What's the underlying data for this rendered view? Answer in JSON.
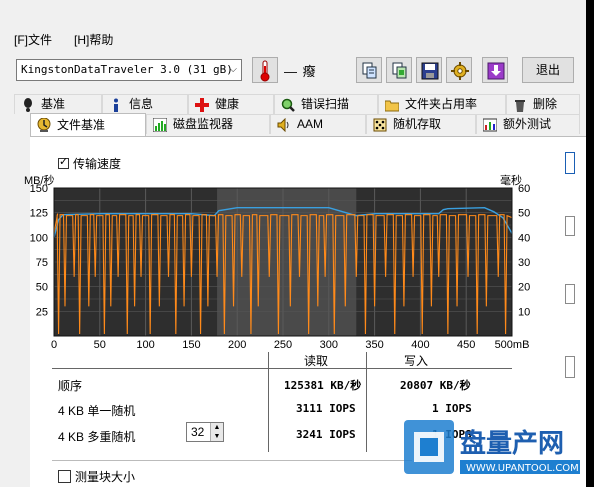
{
  "menu": {
    "file": "[F]文件",
    "help": "[H]帮助"
  },
  "toolbar": {
    "drive": "KingstonDataTraveler 3.0 (31 gB)",
    "temperature": "— 癈",
    "exit_label": "退出",
    "icons": [
      "copy-icon",
      "copy-screen-icon",
      "save-icon",
      "options-icon",
      "download-icon"
    ]
  },
  "tabs_row1": [
    {
      "label": "基准",
      "icon": "exclamation-icon"
    },
    {
      "label": "信息",
      "icon": "info-icon"
    },
    {
      "label": "健康",
      "icon": "health-cross-icon"
    },
    {
      "label": "错误扫描",
      "icon": "magnifier-icon"
    },
    {
      "label": "文件夹占用率",
      "icon": "folder-icon"
    },
    {
      "label": "删除",
      "icon": "trash-icon"
    }
  ],
  "tabs_row2": [
    {
      "label": "文件基准",
      "icon": "file-benchmark-icon",
      "active": true
    },
    {
      "label": "磁盘监视器",
      "icon": "monitor-icon"
    },
    {
      "label": "AAM",
      "icon": "speaker-icon"
    },
    {
      "label": "随机存取",
      "icon": "random-access-icon"
    },
    {
      "label": "额外测试",
      "icon": "extra-tests-icon"
    }
  ],
  "transfer_speed_label": "传输速度",
  "chart_data": {
    "type": "line",
    "ylabel_left": "MB/秒",
    "ylabel_right": "毫秒",
    "xlabel_unit": "mB",
    "x_ticks": [
      0,
      50,
      100,
      150,
      200,
      250,
      300,
      350,
      400,
      450,
      500
    ],
    "y_left_ticks": [
      25,
      50,
      75,
      100,
      125,
      150
    ],
    "y_right_ticks": [
      10,
      20,
      30,
      40,
      50,
      60
    ],
    "ylim_left": [
      0,
      150
    ],
    "ylim_right": [
      0,
      60
    ],
    "xlim": [
      0,
      500
    ],
    "series": [
      {
        "color": "#3aa0e0",
        "values": [
          [
            0,
            100
          ],
          [
            5,
            118
          ],
          [
            10,
            123
          ],
          [
            50,
            124
          ],
          [
            100,
            124
          ],
          [
            150,
            124
          ],
          [
            175,
            122
          ],
          [
            180,
            127
          ],
          [
            200,
            130
          ],
          [
            250,
            130
          ],
          [
            300,
            130
          ],
          [
            315,
            126
          ],
          [
            330,
            122
          ],
          [
            350,
            124
          ],
          [
            400,
            124
          ],
          [
            420,
            124
          ],
          [
            425,
            128
          ],
          [
            430,
            129
          ],
          [
            470,
            130
          ],
          [
            480,
            126
          ],
          [
            490,
            120
          ],
          [
            500,
            104
          ]
        ]
      },
      {
        "color": "#ff8a1a",
        "values": [
          [
            0,
            104
          ],
          [
            10,
            124
          ],
          [
            20,
            122
          ],
          [
            60,
            124
          ],
          [
            100,
            123
          ],
          [
            150,
            123
          ],
          [
            200,
            121
          ],
          [
            250,
            122
          ],
          [
            300,
            123
          ],
          [
            350,
            122
          ],
          [
            400,
            122
          ],
          [
            450,
            122
          ],
          [
            480,
            122
          ],
          [
            500,
            120
          ]
        ]
      }
    ],
    "write_dips": [
      5,
      12,
      22,
      28,
      38,
      45,
      55,
      62,
      70,
      80,
      88,
      95,
      105,
      115,
      125,
      133,
      142,
      150,
      160,
      168,
      178,
      186,
      196,
      205,
      215,
      223,
      235,
      245,
      258,
      268,
      278,
      288,
      296,
      306,
      318,
      330,
      340,
      350,
      362,
      372,
      382,
      392,
      402,
      412,
      420,
      430,
      440,
      452,
      462,
      472,
      485,
      493
    ]
  },
  "results": {
    "header_read": "读取",
    "header_write": "写入",
    "rows": [
      {
        "label": "顺序",
        "read": "125381 KB/秒",
        "write": "20807 KB/秒"
      },
      {
        "label": "4 KB 单一随机",
        "read": "3111 IOPS",
        "write": "1 IOPS"
      },
      {
        "label": "4 KB 多重随机",
        "read": "3241 IOPS",
        "write": "1 IOPS"
      }
    ],
    "queue_depth": "32"
  },
  "bottom_option": "测量块大小",
  "watermark": {
    "brand": "盘量产网",
    "url": "WWW.UPANTOOL.COM"
  }
}
